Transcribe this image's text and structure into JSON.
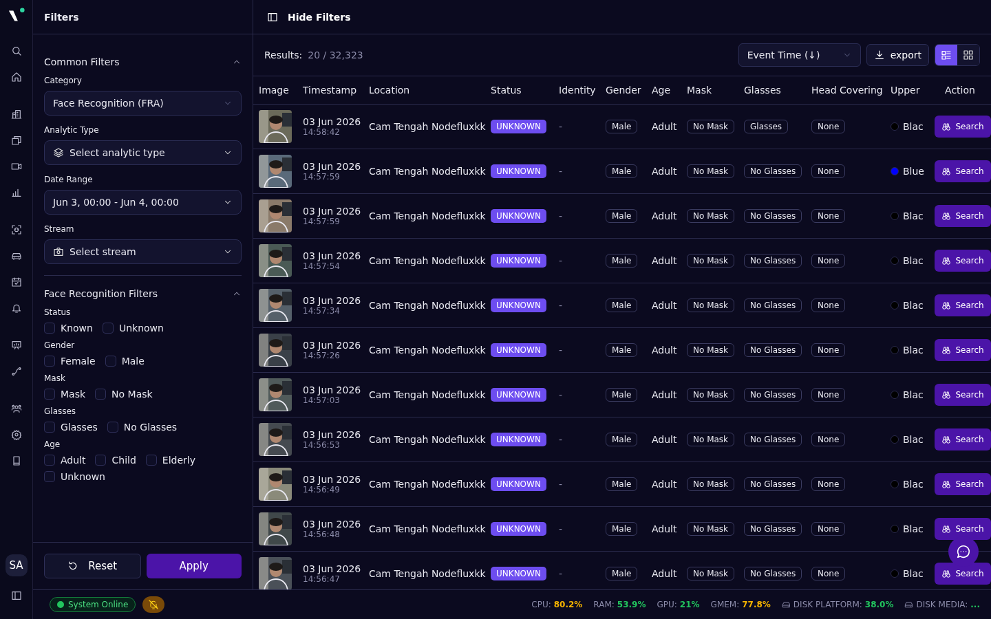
{
  "rail": {
    "avatar": "SA"
  },
  "filters": {
    "title": "Filters",
    "sections": [
      {
        "title": "Common Filters",
        "expanded": true,
        "kind": "dropdowns",
        "fields": [
          {
            "label": "Category",
            "value": "Face Recognition (FRA)",
            "disabled": true
          },
          {
            "label": "Analytic Type",
            "value": "Select analytic type",
            "disabled": false
          },
          {
            "label": "Date Range",
            "value": "Jun 3, 00:00 - Jun 4, 00:00",
            "disabled": false
          },
          {
            "label": "Stream",
            "value": "Select stream",
            "disabled": false
          }
        ]
      },
      {
        "title": "Face Recognition Filters",
        "expanded": true,
        "kind": "checkboxes",
        "groups": [
          {
            "label": "Status",
            "options": [
              {
                "label": "Known",
                "checked": false
              },
              {
                "label": "Unknown",
                "checked": false
              }
            ]
          },
          {
            "label": "Gender",
            "options": [
              {
                "label": "Female",
                "checked": false
              },
              {
                "label": "Male",
                "checked": false
              }
            ]
          },
          {
            "label": "Mask",
            "options": [
              {
                "label": "Mask",
                "checked": false
              },
              {
                "label": "No Mask",
                "checked": false
              }
            ]
          },
          {
            "label": "Glasses",
            "options": [
              {
                "label": "Glasses",
                "checked": false
              },
              {
                "label": "No Glasses",
                "checked": false
              }
            ]
          },
          {
            "label": "Age",
            "options": [
              {
                "label": "Adult",
                "checked": false
              },
              {
                "label": "Child",
                "checked": false
              },
              {
                "label": "Elderly",
                "checked": false
              },
              {
                "label": "Unknown",
                "checked": false
              }
            ]
          }
        ]
      }
    ],
    "buttons": {
      "reset": "Reset",
      "apply": "Apply"
    }
  },
  "toolbar": {
    "toggle": "Hide Filters"
  },
  "results": {
    "label": "Results:",
    "count": "20 / 32,323",
    "sort": "Event Time (↓)",
    "export": "export",
    "views": [
      {
        "kind": "list",
        "selected": true
      },
      {
        "kind": "grid",
        "selected": false
      }
    ]
  },
  "table": {
    "columns": [
      "Image",
      "Timestamp",
      "Location",
      "Status",
      "Identity",
      "Gender",
      "Age",
      "Mask",
      "Glasses",
      "Head Covering",
      "Upper",
      "Action"
    ],
    "rows": [
      {
        "date": "03 Jun 2026",
        "time": "14:58:42",
        "location": "Cam Tengah Nodefluxkk",
        "status": "UNKNOWN",
        "identity": "-",
        "gender": "Male",
        "age": "Adult",
        "mask": "No Mask",
        "glasses": "Glasses",
        "head": "None",
        "upper": "Blac",
        "color": "#000000",
        "action": "Search"
      },
      {
        "date": "03 Jun 2026",
        "time": "14:57:59",
        "location": "Cam Tengah Nodefluxkk",
        "status": "UNKNOWN",
        "identity": "-",
        "gender": "Male",
        "age": "Adult",
        "mask": "No Mask",
        "glasses": "No Glasses",
        "head": "None",
        "upper": "Blue",
        "color": "#0000ff",
        "action": "Search"
      },
      {
        "date": "03 Jun 2026",
        "time": "14:57:59",
        "location": "Cam Tengah Nodefluxkk",
        "status": "UNKNOWN",
        "identity": "-",
        "gender": "Male",
        "age": "Adult",
        "mask": "No Mask",
        "glasses": "No Glasses",
        "head": "None",
        "upper": "Blac",
        "color": "#000000",
        "action": "Search"
      },
      {
        "date": "03 Jun 2026",
        "time": "14:57:54",
        "location": "Cam Tengah Nodefluxkk",
        "status": "UNKNOWN",
        "identity": "-",
        "gender": "Male",
        "age": "Adult",
        "mask": "No Mask",
        "glasses": "No Glasses",
        "head": "None",
        "upper": "Blac",
        "color": "#000000",
        "action": "Search"
      },
      {
        "date": "03 Jun 2026",
        "time": "14:57:34",
        "location": "Cam Tengah Nodefluxkk",
        "status": "UNKNOWN",
        "identity": "-",
        "gender": "Male",
        "age": "Adult",
        "mask": "No Mask",
        "glasses": "No Glasses",
        "head": "None",
        "upper": "Blac",
        "color": "#000000",
        "action": "Search"
      },
      {
        "date": "03 Jun 2026",
        "time": "14:57:26",
        "location": "Cam Tengah Nodefluxkk",
        "status": "UNKNOWN",
        "identity": "-",
        "gender": "Male",
        "age": "Adult",
        "mask": "No Mask",
        "glasses": "No Glasses",
        "head": "None",
        "upper": "Blac",
        "color": "#000000",
        "action": "Search"
      },
      {
        "date": "03 Jun 2026",
        "time": "14:57:03",
        "location": "Cam Tengah Nodefluxkk",
        "status": "UNKNOWN",
        "identity": "-",
        "gender": "Male",
        "age": "Adult",
        "mask": "No Mask",
        "glasses": "No Glasses",
        "head": "None",
        "upper": "Blac",
        "color": "#000000",
        "action": "Search"
      },
      {
        "date": "03 Jun 2026",
        "time": "14:56:53",
        "location": "Cam Tengah Nodefluxkk",
        "status": "UNKNOWN",
        "identity": "-",
        "gender": "Male",
        "age": "Adult",
        "mask": "No Mask",
        "glasses": "No Glasses",
        "head": "None",
        "upper": "Blac",
        "color": "#000000",
        "action": "Search"
      },
      {
        "date": "03 Jun 2026",
        "time": "14:56:49",
        "location": "Cam Tengah Nodefluxkk",
        "status": "UNKNOWN",
        "identity": "-",
        "gender": "Male",
        "age": "Adult",
        "mask": "No Mask",
        "glasses": "No Glasses",
        "head": "None",
        "upper": "Blac",
        "color": "#000000",
        "action": "Search"
      },
      {
        "date": "03 Jun 2026",
        "time": "14:56:48",
        "location": "Cam Tengah Nodefluxkk",
        "status": "UNKNOWN",
        "identity": "-",
        "gender": "Male",
        "age": "Adult",
        "mask": "No Mask",
        "glasses": "No Glasses",
        "head": "None",
        "upper": "Blac",
        "color": "#000000",
        "action": "Search"
      },
      {
        "date": "03 Jun 2026",
        "time": "14:56:47",
        "location": "Cam Tengah Nodefluxkk",
        "status": "UNKNOWN",
        "identity": "-",
        "gender": "Male",
        "age": "Adult",
        "mask": "No Mask",
        "glasses": "No Glasses",
        "head": "None",
        "upper": "Blac",
        "color": "#000000",
        "action": "Search"
      }
    ]
  },
  "status_bar": {
    "system": "System Online",
    "online": true,
    "notifications_muted": true,
    "metrics": [
      {
        "kind": "plain",
        "label": "CPU:",
        "value": "80.2%",
        "color": "#f5b300"
      },
      {
        "kind": "plain",
        "label": "RAM:",
        "value": "53.9%",
        "color": "#22c55e"
      },
      {
        "kind": "plain",
        "label": "GPU:",
        "value": "21%",
        "color": "#22c55e"
      },
      {
        "kind": "plain",
        "label": "GMEM:",
        "value": "77.8%",
        "color": "#f5b300"
      },
      {
        "kind": "disk",
        "label": "DISK PLATFORM:",
        "value": "38.0%",
        "color": "#22c55e"
      },
      {
        "kind": "disk",
        "label": "DISK MEDIA:",
        "value": "...",
        "color": "#22c55e"
      }
    ]
  }
}
